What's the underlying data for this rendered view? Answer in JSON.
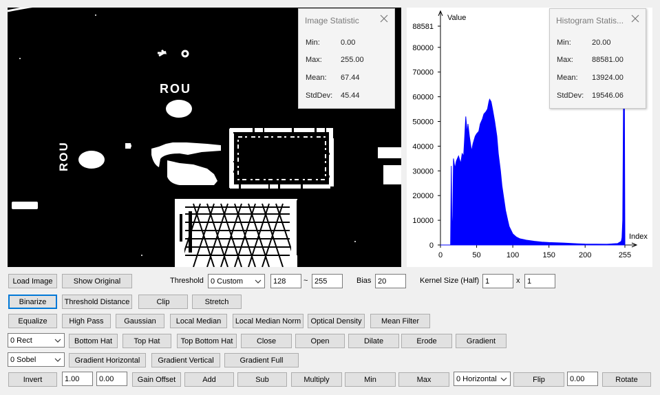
{
  "image_statistic": {
    "title": "Image Statistic",
    "rows": [
      {
        "label": "Min:",
        "value": "0.00"
      },
      {
        "label": "Max:",
        "value": "255.00"
      },
      {
        "label": "Mean:",
        "value": "67.44"
      },
      {
        "label": "StdDev:",
        "value": "45.44"
      }
    ]
  },
  "histogram_statistic": {
    "title": "Histogram Statis...",
    "rows": [
      {
        "label": "Min:",
        "value": "20.00"
      },
      {
        "label": "Max:",
        "value": "88581.00"
      },
      {
        "label": "Mean:",
        "value": "13924.00"
      },
      {
        "label": "StdDev:",
        "value": "19546.06"
      }
    ]
  },
  "image_text": {
    "marking_top": "ROU",
    "marking_side": "ROU"
  },
  "chart_data": {
    "type": "area",
    "ylabel": "Value",
    "xlabel": "Index",
    "xlim": [
      0,
      255
    ],
    "ylim": [
      0,
      88581
    ],
    "x_ticks": [
      "0",
      "50",
      "100",
      "150",
      "200",
      "255"
    ],
    "y_ticks": [
      "0",
      "10000",
      "20000",
      "30000",
      "40000",
      "50000",
      "60000",
      "70000",
      "80000",
      "88581"
    ],
    "color": "#0000ff",
    "series": [
      {
        "x": [
          0,
          14,
          15,
          16,
          17,
          18,
          20,
          22,
          25,
          28,
          30,
          32,
          33,
          35,
          37,
          38,
          40,
          43,
          45,
          48,
          50,
          53,
          55,
          58,
          60,
          63,
          65,
          67,
          68,
          70,
          72,
          75,
          78,
          80,
          83,
          85,
          88,
          90,
          93,
          95,
          100,
          105,
          110,
          120,
          130,
          140,
          150,
          170,
          190,
          200,
          230,
          245,
          250,
          251,
          252,
          253,
          254,
          255
        ],
        "y": [
          0,
          0,
          32000,
          3000,
          12000,
          35000,
          31000,
          34000,
          36000,
          33000,
          37000,
          36000,
          41000,
          52000,
          45000,
          49000,
          44000,
          38000,
          41000,
          44000,
          45000,
          46000,
          49000,
          51000,
          53000,
          54000,
          55000,
          58000,
          59000,
          58000,
          55000,
          50000,
          44000,
          37000,
          30000,
          24000,
          18000,
          14000,
          10000,
          7500,
          4500,
          3200,
          2500,
          1900,
          1500,
          1200,
          1000,
          800,
          500,
          400,
          300,
          600,
          1500,
          3000,
          10000,
          55000,
          88581,
          2000
        ]
      }
    ]
  },
  "controls": {
    "load_image": "Load Image",
    "show_original": "Show Original",
    "threshold_label": "Threshold",
    "threshold_mode": "0 Custom",
    "threshold_low": "128",
    "threshold_sep": "~",
    "threshold_high": "255",
    "bias_label": "Bias",
    "bias_value": "20",
    "kernel_label": "Kernel Size (Half)",
    "kernel_w": "1",
    "kernel_sep": "x",
    "kernel_h": "1",
    "binarize": "Binarize",
    "threshold_distance": "Threshold Distance",
    "clip": "Clip",
    "stretch": "Stretch",
    "equalize": "Equalize",
    "high_pass": "High Pass",
    "gaussian": "Gaussian",
    "local_median": "Local Median",
    "local_median_norm": "Local Median Norm",
    "optical_density": "Optical Density",
    "mean_filter": "Mean Filter",
    "morph_shape": "0 Rect",
    "bottom_hat": "Bottom Hat",
    "top_hat": "Top Hat",
    "top_bottom_hat": "Top Bottom Hat",
    "close": "Close",
    "open": "Open",
    "dilate": "Dilate",
    "erode": "Erode",
    "gradient": "Gradient",
    "gradient_mode": "0 Sobel",
    "gradient_horizontal": "Gradient Horizontal",
    "gradient_vertical": "Gradient Vertical",
    "gradient_full": "Gradient Full",
    "invert": "Invert",
    "gain": "1.00",
    "offset": "0.00",
    "gain_offset": "Gain Offset",
    "add": "Add",
    "sub": "Sub",
    "multiply": "Multiply",
    "min": "Min",
    "max": "Max",
    "flip_mode": "0 Horizontal",
    "flip": "Flip",
    "rotate_angle": "0.00",
    "rotate": "Rotate"
  }
}
